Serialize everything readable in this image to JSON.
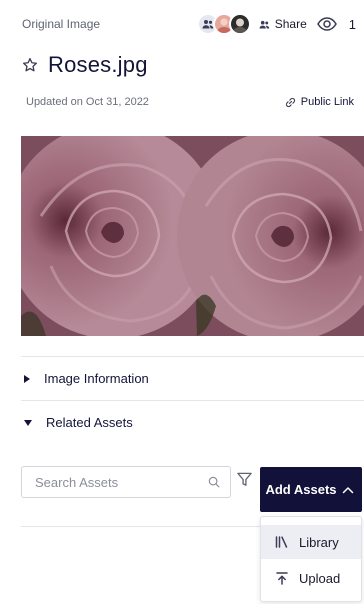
{
  "header": {
    "breadcrumb": "Original Image",
    "share_label": "Share",
    "view_count": "1"
  },
  "asset": {
    "title": "Roses.jpg",
    "updated": "Updated on Oct 31, 2022",
    "public_link_label": "Public Link"
  },
  "sections": {
    "image_information": "Image Information",
    "related_assets": "Related Assets"
  },
  "search": {
    "placeholder": "Search Assets"
  },
  "add_assets": {
    "label": "Add Assets",
    "menu": [
      "Library",
      "Upload"
    ]
  },
  "colors": {
    "primary": "#11113a",
    "text": "#14143a",
    "muted": "#6b6f7a",
    "border": "#d3d5dc"
  },
  "icons": [
    "users-icon",
    "star-outline-icon",
    "link-icon",
    "eye-icon",
    "search-icon",
    "filter-icon",
    "chevron-up-icon",
    "library-icon",
    "upload-icon"
  ]
}
